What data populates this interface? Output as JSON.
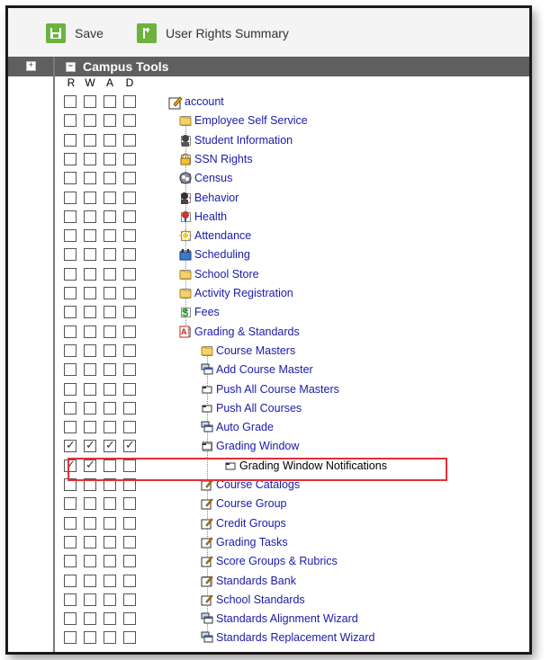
{
  "toolbar": {
    "save_label": "Save",
    "user_rights_label": "User Rights Summary"
  },
  "section": {
    "title": "Campus Tools",
    "columns": [
      "R",
      "W",
      "A",
      "D"
    ]
  },
  "tree": [
    {
      "label": "account",
      "level": 0,
      "icon": "account-icon",
      "expander": false,
      "checks": [
        false,
        false,
        false,
        false
      ]
    },
    {
      "label": "Employee Self Service",
      "level": 1,
      "icon": "folder-icon",
      "expander": "+",
      "checks": [
        false,
        false,
        false,
        false
      ]
    },
    {
      "label": "Student Information",
      "level": 1,
      "icon": "student-icon",
      "expander": "+",
      "checks": [
        false,
        false,
        false,
        false
      ]
    },
    {
      "label": "SSN Rights",
      "level": 1,
      "icon": "lock-icon",
      "expander": "+",
      "checks": [
        false,
        false,
        false,
        false
      ]
    },
    {
      "label": "Census",
      "level": 1,
      "icon": "census-icon",
      "expander": "+",
      "checks": [
        false,
        false,
        false,
        false
      ]
    },
    {
      "label": "Behavior",
      "level": 1,
      "icon": "behavior-icon",
      "expander": "+",
      "checks": [
        false,
        false,
        false,
        false
      ]
    },
    {
      "label": "Health",
      "level": 1,
      "icon": "health-icon",
      "expander": "+",
      "checks": [
        false,
        false,
        false,
        false
      ]
    },
    {
      "label": "Attendance",
      "level": 1,
      "icon": "attendance-icon",
      "expander": "+",
      "checks": [
        false,
        false,
        false,
        false
      ]
    },
    {
      "label": "Scheduling",
      "level": 1,
      "icon": "scheduling-icon",
      "expander": "+",
      "checks": [
        false,
        false,
        false,
        false
      ]
    },
    {
      "label": "School Store",
      "level": 1,
      "icon": "folder-icon",
      "expander": "+",
      "checks": [
        false,
        false,
        false,
        false
      ]
    },
    {
      "label": "Activity Registration",
      "level": 1,
      "icon": "folder-icon",
      "expander": "+",
      "checks": [
        false,
        false,
        false,
        false
      ]
    },
    {
      "label": "Fees",
      "level": 1,
      "icon": "dollar-icon",
      "expander": "+",
      "checks": [
        false,
        false,
        false,
        false
      ]
    },
    {
      "label": "Grading & Standards",
      "level": 1,
      "icon": "grading-icon",
      "expander": "-",
      "checks": [
        false,
        false,
        false,
        false
      ]
    },
    {
      "label": "Course Masters",
      "level": 2,
      "icon": "folder-icon",
      "expander": "+",
      "checks": [
        false,
        false,
        false,
        false
      ]
    },
    {
      "label": "Add Course Master",
      "level": 2,
      "icon": "windows-icon",
      "expander": false,
      "checks": [
        false,
        false,
        false,
        false
      ]
    },
    {
      "label": "Push All Course Masters",
      "level": 2,
      "icon": "page-icon",
      "expander": false,
      "checks": [
        false,
        false,
        false,
        false
      ]
    },
    {
      "label": "Push All Courses",
      "level": 2,
      "icon": "page-icon",
      "expander": false,
      "checks": [
        false,
        false,
        false,
        false
      ]
    },
    {
      "label": "Auto Grade",
      "level": 2,
      "icon": "windows-icon",
      "expander": false,
      "checks": [
        false,
        false,
        false,
        false
      ]
    },
    {
      "label": "Grading Window",
      "level": 2,
      "icon": "page-icon",
      "expander": "-",
      "checks": [
        true,
        true,
        true,
        true
      ]
    },
    {
      "label": "Grading Window Notifications",
      "level": 3,
      "icon": "page-icon",
      "expander": false,
      "checks": [
        true,
        true,
        false,
        false
      ]
    },
    {
      "label": "Course Catalogs",
      "level": 2,
      "icon": "edit-icon",
      "expander": false,
      "checks": [
        false,
        false,
        false,
        false
      ]
    },
    {
      "label": "Course Group",
      "level": 2,
      "icon": "edit-icon",
      "expander": false,
      "checks": [
        false,
        false,
        false,
        false
      ]
    },
    {
      "label": "Credit Groups",
      "level": 2,
      "icon": "edit-icon",
      "expander": false,
      "checks": [
        false,
        false,
        false,
        false
      ]
    },
    {
      "label": "Grading Tasks",
      "level": 2,
      "icon": "edit-icon",
      "expander": false,
      "checks": [
        false,
        false,
        false,
        false
      ]
    },
    {
      "label": "Score Groups & Rubrics",
      "level": 2,
      "icon": "edit-icon",
      "expander": false,
      "checks": [
        false,
        false,
        false,
        false
      ]
    },
    {
      "label": "Standards Bank",
      "level": 2,
      "icon": "edit-icon",
      "expander": "+",
      "checks": [
        false,
        false,
        false,
        false
      ]
    },
    {
      "label": "School Standards",
      "level": 2,
      "icon": "edit-icon",
      "expander": false,
      "checks": [
        false,
        false,
        false,
        false
      ]
    },
    {
      "label": "Standards Alignment Wizard",
      "level": 2,
      "icon": "windows-icon",
      "expander": false,
      "checks": [
        false,
        false,
        false,
        false
      ]
    },
    {
      "label": "Standards Replacement Wizard",
      "level": 2,
      "icon": "windows-icon",
      "expander": false,
      "checks": [
        false,
        false,
        false,
        false
      ]
    }
  ],
  "colors": {
    "accent": "#6cb33e",
    "section_bar": "#5f5f5f",
    "link": "#1a1aa8",
    "highlight": "#e0303a"
  }
}
